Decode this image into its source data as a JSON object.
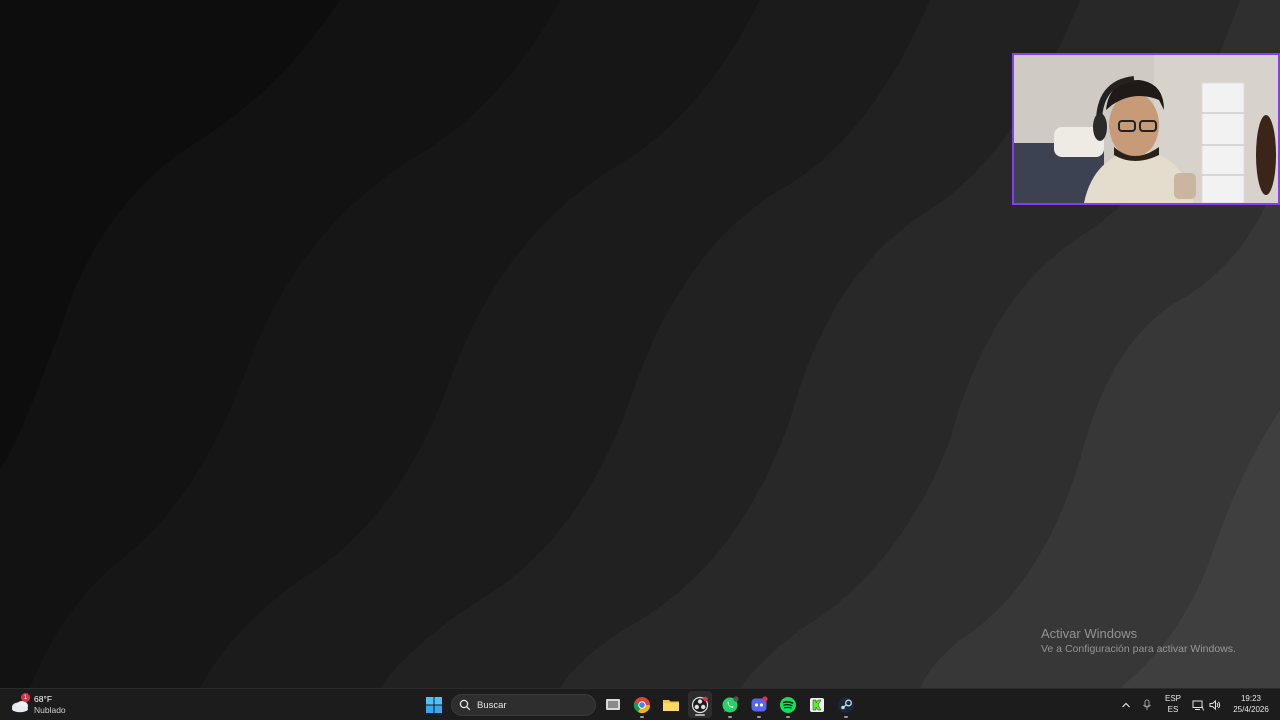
{
  "desktop": {
    "webcam": {
      "description_shown": ""
    }
  },
  "watermark": {
    "title": "Activar Windows",
    "subtitle": "Ve a Configuración para activar Windows."
  },
  "taskbar": {
    "weather": {
      "temperature": "68°F",
      "condition": "Nublado",
      "badge": "1"
    },
    "search": {
      "placeholder": "Buscar"
    },
    "apps": [
      {
        "name": "Vista de tareas",
        "icon": "task-view-icon"
      },
      {
        "name": "Google Chrome",
        "icon": "chrome-icon"
      },
      {
        "name": "Explorador de archivos",
        "icon": "folder-icon"
      },
      {
        "name": "OBS Studio",
        "icon": "obs-icon"
      },
      {
        "name": "WhatsApp",
        "icon": "whatsapp-icon"
      },
      {
        "name": "Discord",
        "icon": "discord-icon"
      },
      {
        "name": "Spotify",
        "icon": "spotify-icon"
      },
      {
        "name": "Kick",
        "icon": "kick-icon"
      },
      {
        "name": "Steam",
        "icon": "steam-icon"
      }
    ],
    "tray": {
      "lang_top": "ESP",
      "lang_bottom": "ES",
      "time": "19:23",
      "date": "25/4/2026"
    }
  }
}
